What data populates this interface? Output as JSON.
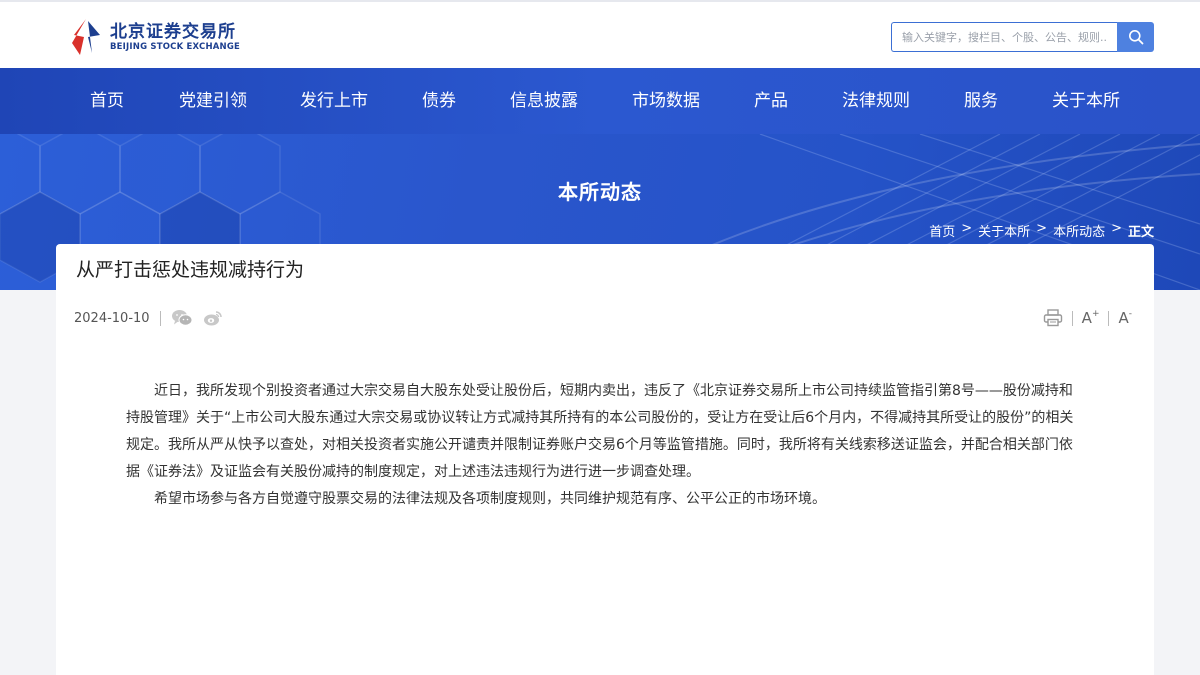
{
  "header": {
    "logo_cn": "北京证券交易所",
    "logo_en": "BEIJING STOCK EXCHANGE",
    "search_placeholder": "输入关键字，搜栏目、个股、公告、规则..."
  },
  "nav": {
    "items": [
      "首页",
      "党建引领",
      "发行上市",
      "债券",
      "信息披露",
      "市场数据",
      "产品",
      "法律规则",
      "服务",
      "关于本所"
    ]
  },
  "banner": {
    "title": "本所动态",
    "breadcrumb": [
      "首页",
      "关于本所",
      "本所动态",
      "正文"
    ],
    "separator": ">"
  },
  "article": {
    "title": "从严打击惩处违规减持行为",
    "date": "2024-10-10",
    "font_increase": "A",
    "font_increase_sup": "+",
    "font_decrease": "A",
    "font_decrease_sup": "-",
    "paragraphs": [
      "近日，我所发现个别投资者通过大宗交易自大股东处受让股份后，短期内卖出，违反了《北京证券交易所上市公司持续监管指引第8号——股份减持和持股管理》关于“上市公司大股东通过大宗交易或协议转让方式减持其所持有的本公司股份的，受让方在受让后6个月内，不得减持其所受让的股份”的相关规定。我所从严从快予以查处，对相关投资者实施公开谴责并限制证券账户交易6个月等监管措施。同时，我所将有关线索移送证监会，并配合相关部门依据《证券法》及证监会有关股份减持的制度规定，对上述违法违规行为进行进一步调查处理。",
      "希望市场参与各方自觉遵守股票交易的法律法规及各项制度规则，共同维护规范有序、公平公正的市场环境。"
    ]
  },
  "icons": {
    "logo": "bse-logo-icon",
    "search": "search-icon",
    "wechat": "wechat-icon",
    "weibo": "weibo-icon",
    "print": "print-icon"
  },
  "colors": {
    "brand_blue": "#1d3f8f",
    "nav_blue": "#2b58d0",
    "logo_red": "#d9312b",
    "search_button": "#4e81e0"
  }
}
